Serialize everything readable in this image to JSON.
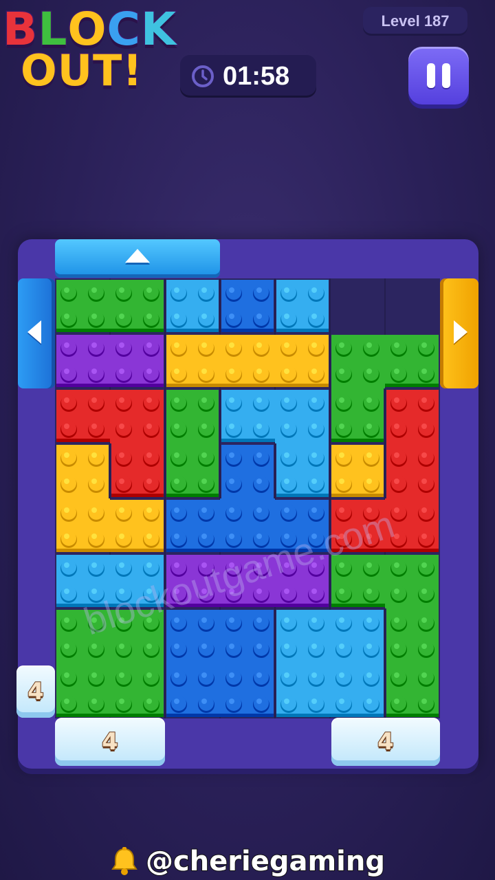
{
  "header": {
    "logo_line1": [
      "B",
      "L",
      "O",
      "C",
      "K"
    ],
    "logo_line2": "OUT!",
    "logo_colors": [
      "#e8333b",
      "#3fbf3f",
      "#ffc21e",
      "#3aa0f0",
      "#3fc2e0"
    ],
    "level_label": "Level 187",
    "timer": "01:58",
    "pause_icon": "pause-icon",
    "clock_icon": "clock-icon"
  },
  "colors": {
    "green": "#33b533",
    "cyan": "#35aef0",
    "blue": "#1f6fe0",
    "purple": "#8a36d6",
    "yellow": "#ffc21e",
    "red": "#e52a2a"
  },
  "board": {
    "columns": 7,
    "rows": 8,
    "gates": [
      {
        "id": "top-blue",
        "color": "blue",
        "direction": "up"
      },
      {
        "id": "left-blue",
        "color": "blue",
        "direction": "left"
      },
      {
        "id": "right-yellow",
        "color": "yellow",
        "direction": "right"
      }
    ],
    "frozen_gates": [
      {
        "id": "ice-left",
        "count": "4"
      },
      {
        "id": "ice-bottom-1",
        "count": "4"
      },
      {
        "id": "ice-bottom-2",
        "count": "4"
      }
    ],
    "blocks": [
      {
        "color": "green",
        "cells": [
          [
            0,
            0
          ],
          [
            1,
            0
          ]
        ]
      },
      {
        "color": "cyan",
        "cells": [
          [
            2,
            0
          ]
        ]
      },
      {
        "color": "blue",
        "cells": [
          [
            3,
            0
          ]
        ]
      },
      {
        "color": "cyan",
        "cells": [
          [
            4,
            0
          ]
        ]
      },
      {
        "color": "purple",
        "cells": [
          [
            0,
            1
          ],
          [
            1,
            1
          ]
        ]
      },
      {
        "color": "yellow",
        "cells": [
          [
            2,
            1
          ],
          [
            3,
            1
          ],
          [
            4,
            1
          ]
        ]
      },
      {
        "color": "green",
        "cells": [
          [
            5,
            1
          ],
          [
            6,
            1
          ],
          [
            5,
            2
          ]
        ]
      },
      {
        "color": "red",
        "cells": [
          [
            0,
            2
          ],
          [
            1,
            2
          ],
          [
            1,
            3
          ]
        ]
      },
      {
        "color": "green",
        "cells": [
          [
            2,
            2
          ],
          [
            2,
            3
          ]
        ]
      },
      {
        "color": "cyan",
        "cells": [
          [
            3,
            2
          ],
          [
            4,
            2
          ],
          [
            4,
            3
          ]
        ]
      },
      {
        "color": "red",
        "cells": [
          [
            6,
            2
          ],
          [
            6,
            3
          ],
          [
            5,
            4
          ],
          [
            6,
            4
          ]
        ]
      },
      {
        "color": "yellow",
        "cells": [
          [
            0,
            3
          ],
          [
            0,
            4
          ],
          [
            1,
            4
          ]
        ]
      },
      {
        "color": "blue",
        "cells": [
          [
            3,
            3
          ],
          [
            2,
            4
          ],
          [
            3,
            4
          ],
          [
            4,
            4
          ]
        ]
      },
      {
        "color": "yellow",
        "cells": [
          [
            5,
            3
          ]
        ]
      },
      {
        "color": "cyan",
        "cells": [
          [
            0,
            5
          ],
          [
            1,
            5
          ]
        ]
      },
      {
        "color": "purple",
        "cells": [
          [
            2,
            5
          ],
          [
            3,
            5
          ],
          [
            4,
            5
          ]
        ]
      },
      {
        "color": "green",
        "cells": [
          [
            5,
            5
          ],
          [
            6,
            5
          ],
          [
            6,
            6
          ],
          [
            6,
            7
          ]
        ]
      },
      {
        "color": "green",
        "cells": [
          [
            0,
            6
          ],
          [
            1,
            6
          ],
          [
            0,
            7
          ],
          [
            1,
            7
          ]
        ]
      },
      {
        "color": "blue",
        "cells": [
          [
            2,
            6
          ],
          [
            3,
            6
          ],
          [
            2,
            7
          ],
          [
            3,
            7
          ]
        ]
      },
      {
        "color": "cyan",
        "cells": [
          [
            4,
            6
          ],
          [
            5,
            6
          ],
          [
            4,
            7
          ],
          [
            5,
            7
          ]
        ]
      }
    ]
  },
  "watermark": "blockoutgame.com",
  "footer": {
    "handle": "@cheriegaming",
    "icon": "bell-icon"
  }
}
